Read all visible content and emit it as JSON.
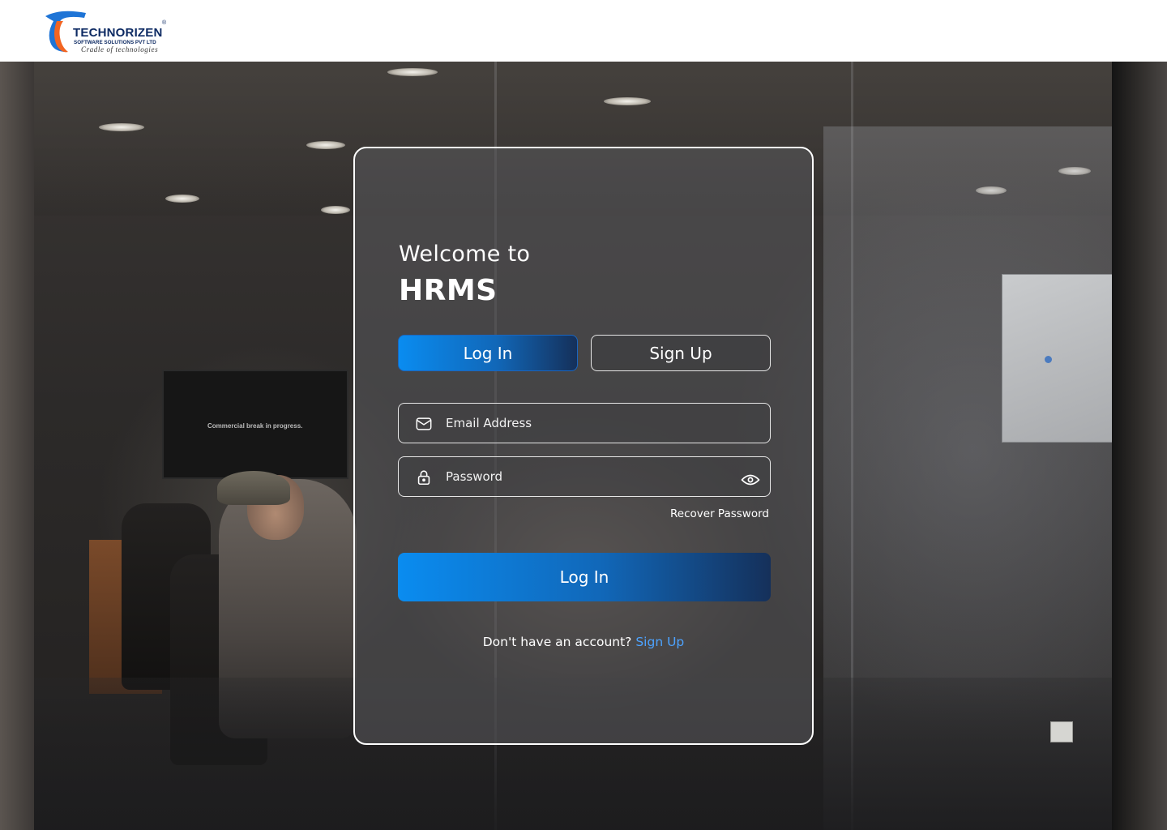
{
  "brand": {
    "name": "TECHNORIZEN",
    "registered": "®",
    "subtitle": "SOFTWARE SOLUTIONS PVT LTD",
    "tagline": "Cradle of technologies",
    "colors": {
      "navy": "#0d2a63",
      "orange": "#f26522",
      "blue": "#1a73e8"
    }
  },
  "background": {
    "tv_text": "Commercial break in progress."
  },
  "login_card": {
    "welcome": "Welcome to",
    "title": "HRMS",
    "tabs": [
      {
        "label": "Log In",
        "active": true
      },
      {
        "label": "Sign Up",
        "active": false
      }
    ],
    "email": {
      "placeholder": "Email Address",
      "value": "",
      "icon": "mail-icon"
    },
    "password": {
      "placeholder": "Password",
      "value": "",
      "icon": "lock-icon",
      "toggle_icon": "eye-icon"
    },
    "recover_label": "Recover Password",
    "submit_label": "Log In",
    "footer": {
      "prompt": "Don't have an account? ",
      "link": "Sign Up"
    },
    "accent": "#0a8cf0",
    "link_color": "#4da3ff"
  }
}
